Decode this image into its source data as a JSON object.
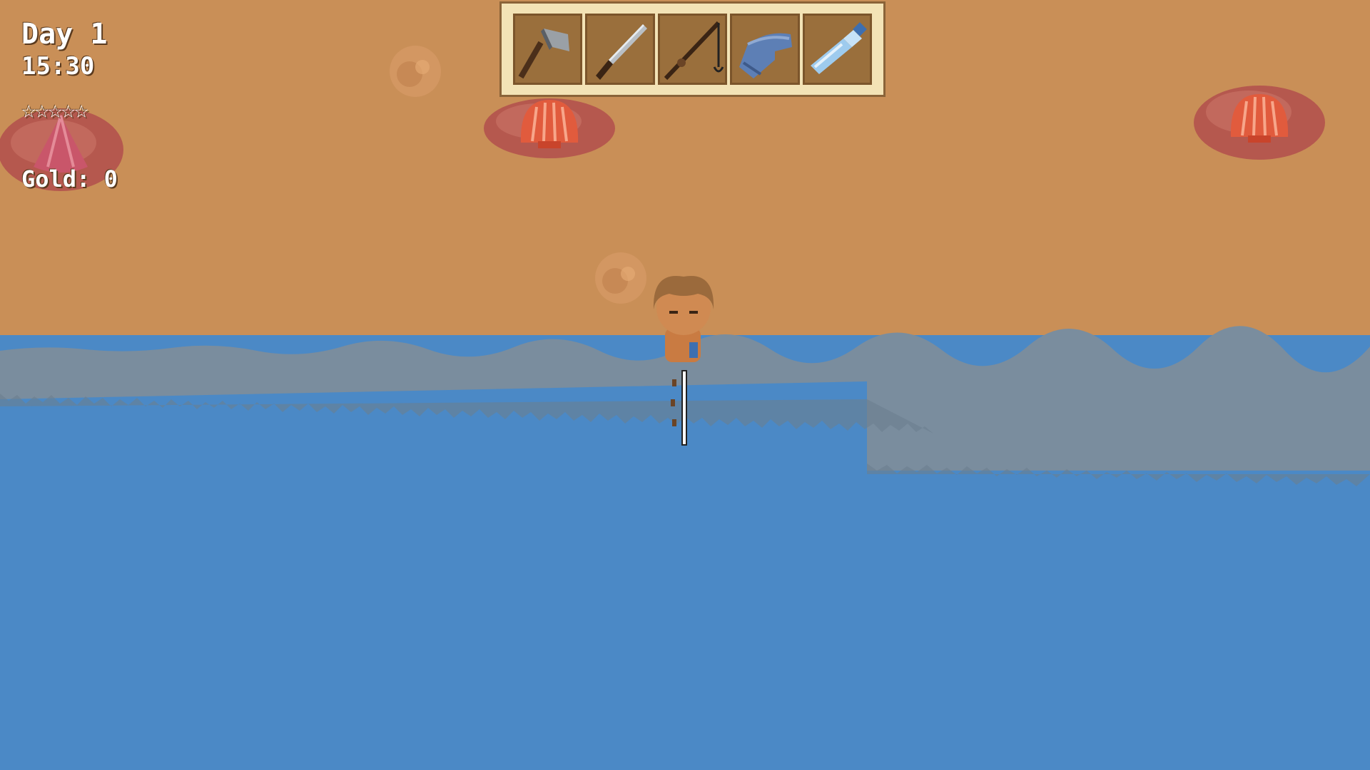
{
  "hud": {
    "day": "Day 1",
    "time": "15:30",
    "stars": "☆☆☆☆☆",
    "gold": "Gold: 0"
  },
  "toolbar": {
    "slots": [
      {
        "icon": "axe-icon"
      },
      {
        "icon": "knife-icon"
      },
      {
        "icon": "fishing-rod-icon"
      },
      {
        "icon": "blue-glove-icon"
      },
      {
        "icon": "water-bottle-icon"
      }
    ]
  },
  "colors": {
    "sand": "#c98f57",
    "water": "#4b89c6",
    "shallow_water": "#7a8d9e",
    "rock": "#b5584e",
    "shell": "#e15b3d",
    "toolbar_bg": "#f3e3b6",
    "slot_bg": "#9a6f3c"
  }
}
